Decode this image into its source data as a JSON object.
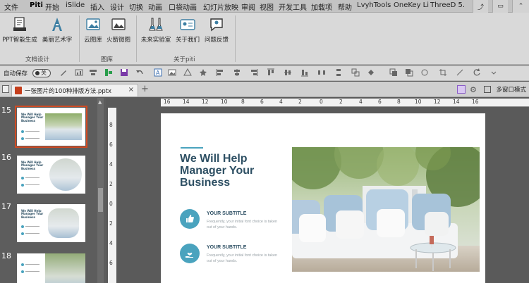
{
  "menubar": {
    "items": [
      "文件",
      "Piti",
      "开始",
      "iSlide",
      "插入",
      "设计",
      "切换",
      "动画",
      "口袋动画",
      "幻灯片放映",
      "审阅",
      "视图",
      "开发工具",
      "加载项",
      "帮助",
      "LvyhTools",
      "OneKey Li",
      "ThreeD 5."
    ],
    "active": "Piti"
  },
  "ribbon": {
    "buttons": {
      "ppt_smart": "PPT智能生成",
      "beauty_font": "美丽艺术字",
      "cloud_gallery": "云图库",
      "mountain_gallery": "火箭微图",
      "future_lab": "未来实验室",
      "about_us": "关于我们",
      "feedback": "问题反馈"
    },
    "groups": {
      "doc_design": "文档设计",
      "gallery": "图库",
      "about_piti": "关于piti"
    }
  },
  "qat": {
    "autosave_label": "自动保存",
    "toggle_state": "关"
  },
  "tabbar": {
    "doc_tab_title": "一张图片的100种排版方法.pptx",
    "multi_window": "多窗口模式"
  },
  "thumbnails": {
    "numbers": [
      "15",
      "16",
      "17",
      "18"
    ],
    "selected": "15"
  },
  "ruler": {
    "ticks": [
      "16",
      "14",
      "12",
      "10",
      "8",
      "6",
      "4",
      "2",
      "0",
      "2",
      "4",
      "6",
      "8",
      "10",
      "12",
      "14",
      "16"
    ],
    "vticks": [
      "8",
      "6",
      "4",
      "2",
      "0",
      "2",
      "4",
      "6"
    ]
  },
  "slide": {
    "title": "We Will Help Manager Your Business",
    "subtitle_1": "YOUR SUBTITLE",
    "text_1": "Frequently, your initial font choice is taken out of your hands.",
    "subtitle_2": "YOUR SUBTITLE",
    "text_2": "Frequently, your initial font choice is taken out of your hands.",
    "accent_color": "#4aa3be",
    "title_color": "#2d4f63"
  }
}
